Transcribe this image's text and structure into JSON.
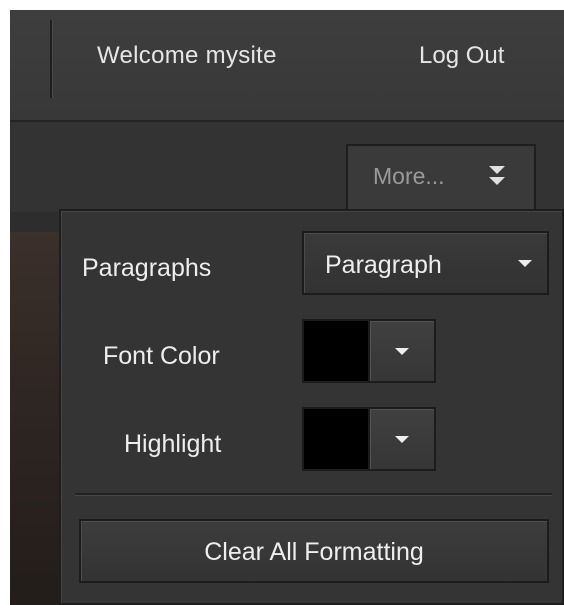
{
  "header": {
    "welcome_text": "Welcome mysite",
    "logout_label": "Log Out"
  },
  "toolbar": {
    "more_label": "More...",
    "more_icon": "double-chevron-down-icon"
  },
  "format_panel": {
    "paragraphs_label": "Paragraphs",
    "paragraph_select_value": "Paragraph",
    "font_color_label": "Font Color",
    "font_color_value": "#000000",
    "highlight_label": "Highlight",
    "highlight_value": "#000000",
    "clear_button_label": "Clear All Formatting"
  },
  "colors": {
    "panel_background": "#343434",
    "text": "#eeeeee",
    "muted_text": "#9a9a9a"
  }
}
